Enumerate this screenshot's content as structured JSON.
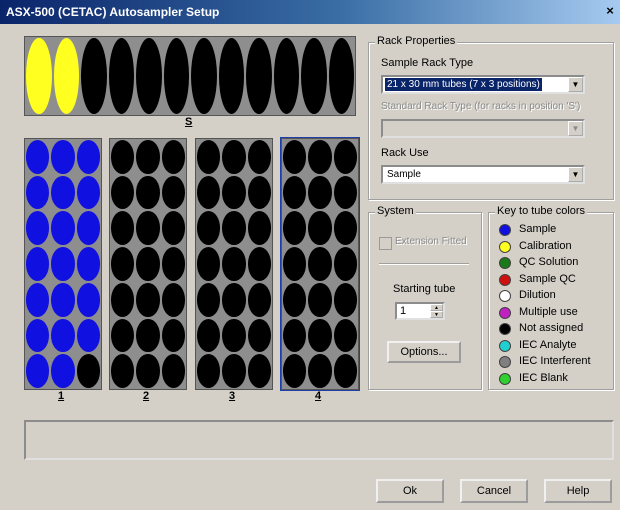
{
  "window": {
    "title": "ASX-500 (CETAC) Autosampler Setup",
    "close_symbol": "×"
  },
  "racks": {
    "standard": {
      "label": "S",
      "tubes": [
        "yellow",
        "yellow",
        "black",
        "black",
        "black",
        "black",
        "black",
        "black",
        "black",
        "black",
        "black",
        "black"
      ]
    },
    "numbered": [
      {
        "label": "1",
        "tubes": [
          "blue",
          "blue",
          "blue",
          "blue",
          "blue",
          "blue",
          "blue",
          "blue",
          "blue",
          "blue",
          "blue",
          "blue",
          "blue",
          "blue",
          "blue",
          "blue",
          "blue",
          "blue",
          "blue",
          "blue",
          "black"
        ]
      },
      {
        "label": "2",
        "tubes": []
      },
      {
        "label": "3",
        "tubes": []
      },
      {
        "label": "4",
        "tubes": []
      }
    ]
  },
  "rack_properties": {
    "title": "Rack Properties",
    "sample_rack_type_label": "Sample Rack Type",
    "sample_rack_type_value": "21 x 30 mm tubes (7 x 3 positions)",
    "standard_rack_type_label": "Standard Rack Type (for racks in position 'S')",
    "standard_rack_type_value": "",
    "rack_use_label": "Rack Use",
    "rack_use_value": "Sample"
  },
  "system": {
    "title": "System",
    "extension_fitted_label": "Extension Fitted",
    "starting_tube_label": "Starting tube",
    "starting_tube_value": "1",
    "options_button": "Options..."
  },
  "key": {
    "title": "Key to tube colors",
    "items": [
      {
        "label": "Sample",
        "color": "#1010e0"
      },
      {
        "label": "Calibration",
        "color": "#ffff20"
      },
      {
        "label": "QC Solution",
        "color": "#1a7a1a"
      },
      {
        "label": "Sample QC",
        "color": "#d01010"
      },
      {
        "label": "Dilution",
        "color": "#ffffff"
      },
      {
        "label": "Multiple use",
        "color": "#c020c0"
      },
      {
        "label": "Not assigned",
        "color": "#000000"
      },
      {
        "label": "IEC Analyte",
        "color": "#20d0d0"
      },
      {
        "label": "IEC Interferent",
        "color": "#808080"
      },
      {
        "label": "IEC Blank",
        "color": "#30d030"
      }
    ]
  },
  "buttons": {
    "ok": "Ok",
    "cancel": "Cancel",
    "help": "Help"
  },
  "colors": {
    "blue": "#1010e0",
    "yellow": "#ffff20",
    "black": "#000000",
    "rack_bg": "#8e8e8e"
  }
}
